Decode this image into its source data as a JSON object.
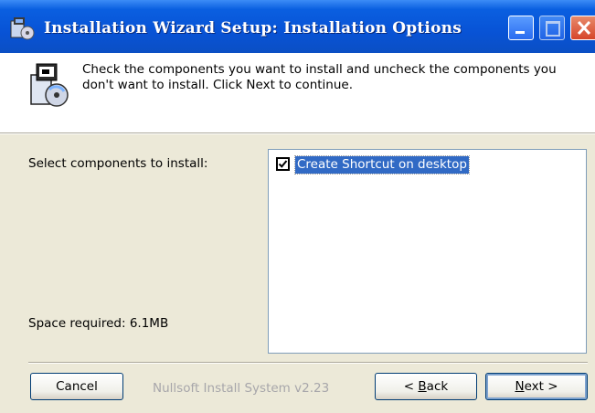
{
  "window": {
    "title": "Installation Wizard Setup: Installation Options",
    "controls": [
      "minimize-icon",
      "maximize-icon",
      "close-icon"
    ],
    "title_color": "#0853d6"
  },
  "header": {
    "text": "Check the components you want to install and uncheck the components you don't want to install. Click Next to continue."
  },
  "main": {
    "select_label": "Select components to install:",
    "space_required": "Space required: 6.1MB",
    "components": [
      {
        "label": "Create Shortcut on desktop",
        "checked": true
      }
    ]
  },
  "footer": {
    "cancel_label": "Cancel",
    "branding": "Nullsoft Install System v2.23",
    "back_label": "< Back",
    "back_accel": "B",
    "next_label": "Next >",
    "next_accel": "N"
  },
  "colors": {
    "selection": "#316ac5",
    "face": "#ece9d8",
    "disabled_text": "#a7a6aa"
  }
}
